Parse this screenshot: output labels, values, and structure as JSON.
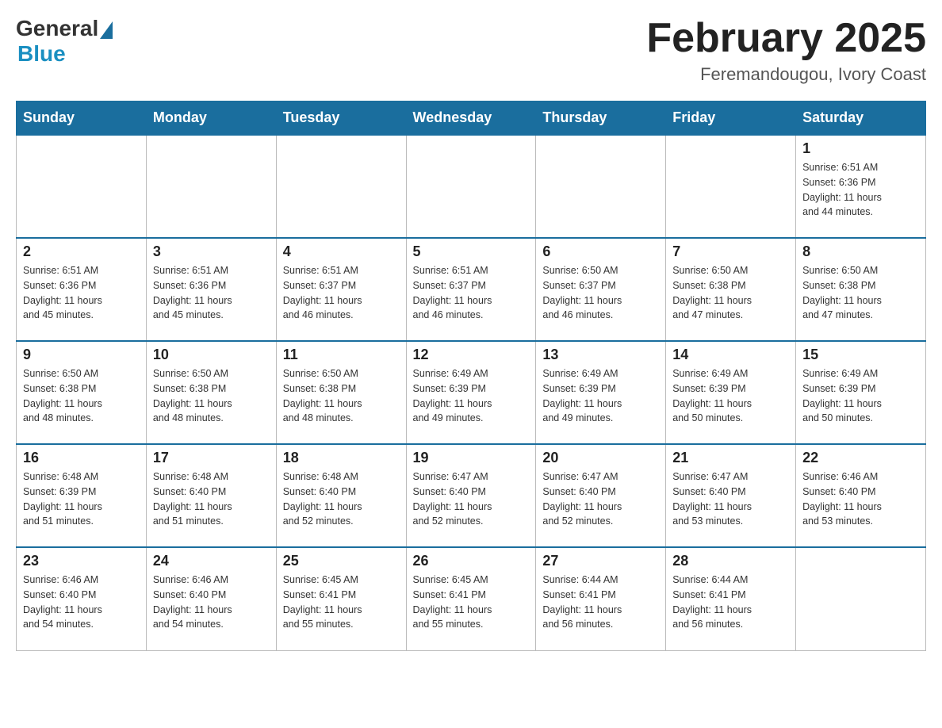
{
  "logo": {
    "general": "General",
    "blue": "Blue"
  },
  "title": "February 2025",
  "location": "Feremandougou, Ivory Coast",
  "days_of_week": [
    "Sunday",
    "Monday",
    "Tuesday",
    "Wednesday",
    "Thursday",
    "Friday",
    "Saturday"
  ],
  "weeks": [
    [
      {
        "day": "",
        "info": ""
      },
      {
        "day": "",
        "info": ""
      },
      {
        "day": "",
        "info": ""
      },
      {
        "day": "",
        "info": ""
      },
      {
        "day": "",
        "info": ""
      },
      {
        "day": "",
        "info": ""
      },
      {
        "day": "1",
        "info": "Sunrise: 6:51 AM\nSunset: 6:36 PM\nDaylight: 11 hours\nand 44 minutes."
      }
    ],
    [
      {
        "day": "2",
        "info": "Sunrise: 6:51 AM\nSunset: 6:36 PM\nDaylight: 11 hours\nand 45 minutes."
      },
      {
        "day": "3",
        "info": "Sunrise: 6:51 AM\nSunset: 6:36 PM\nDaylight: 11 hours\nand 45 minutes."
      },
      {
        "day": "4",
        "info": "Sunrise: 6:51 AM\nSunset: 6:37 PM\nDaylight: 11 hours\nand 46 minutes."
      },
      {
        "day": "5",
        "info": "Sunrise: 6:51 AM\nSunset: 6:37 PM\nDaylight: 11 hours\nand 46 minutes."
      },
      {
        "day": "6",
        "info": "Sunrise: 6:50 AM\nSunset: 6:37 PM\nDaylight: 11 hours\nand 46 minutes."
      },
      {
        "day": "7",
        "info": "Sunrise: 6:50 AM\nSunset: 6:38 PM\nDaylight: 11 hours\nand 47 minutes."
      },
      {
        "day": "8",
        "info": "Sunrise: 6:50 AM\nSunset: 6:38 PM\nDaylight: 11 hours\nand 47 minutes."
      }
    ],
    [
      {
        "day": "9",
        "info": "Sunrise: 6:50 AM\nSunset: 6:38 PM\nDaylight: 11 hours\nand 48 minutes."
      },
      {
        "day": "10",
        "info": "Sunrise: 6:50 AM\nSunset: 6:38 PM\nDaylight: 11 hours\nand 48 minutes."
      },
      {
        "day": "11",
        "info": "Sunrise: 6:50 AM\nSunset: 6:38 PM\nDaylight: 11 hours\nand 48 minutes."
      },
      {
        "day": "12",
        "info": "Sunrise: 6:49 AM\nSunset: 6:39 PM\nDaylight: 11 hours\nand 49 minutes."
      },
      {
        "day": "13",
        "info": "Sunrise: 6:49 AM\nSunset: 6:39 PM\nDaylight: 11 hours\nand 49 minutes."
      },
      {
        "day": "14",
        "info": "Sunrise: 6:49 AM\nSunset: 6:39 PM\nDaylight: 11 hours\nand 50 minutes."
      },
      {
        "day": "15",
        "info": "Sunrise: 6:49 AM\nSunset: 6:39 PM\nDaylight: 11 hours\nand 50 minutes."
      }
    ],
    [
      {
        "day": "16",
        "info": "Sunrise: 6:48 AM\nSunset: 6:39 PM\nDaylight: 11 hours\nand 51 minutes."
      },
      {
        "day": "17",
        "info": "Sunrise: 6:48 AM\nSunset: 6:40 PM\nDaylight: 11 hours\nand 51 minutes."
      },
      {
        "day": "18",
        "info": "Sunrise: 6:48 AM\nSunset: 6:40 PM\nDaylight: 11 hours\nand 52 minutes."
      },
      {
        "day": "19",
        "info": "Sunrise: 6:47 AM\nSunset: 6:40 PM\nDaylight: 11 hours\nand 52 minutes."
      },
      {
        "day": "20",
        "info": "Sunrise: 6:47 AM\nSunset: 6:40 PM\nDaylight: 11 hours\nand 52 minutes."
      },
      {
        "day": "21",
        "info": "Sunrise: 6:47 AM\nSunset: 6:40 PM\nDaylight: 11 hours\nand 53 minutes."
      },
      {
        "day": "22",
        "info": "Sunrise: 6:46 AM\nSunset: 6:40 PM\nDaylight: 11 hours\nand 53 minutes."
      }
    ],
    [
      {
        "day": "23",
        "info": "Sunrise: 6:46 AM\nSunset: 6:40 PM\nDaylight: 11 hours\nand 54 minutes."
      },
      {
        "day": "24",
        "info": "Sunrise: 6:46 AM\nSunset: 6:40 PM\nDaylight: 11 hours\nand 54 minutes."
      },
      {
        "day": "25",
        "info": "Sunrise: 6:45 AM\nSunset: 6:41 PM\nDaylight: 11 hours\nand 55 minutes."
      },
      {
        "day": "26",
        "info": "Sunrise: 6:45 AM\nSunset: 6:41 PM\nDaylight: 11 hours\nand 55 minutes."
      },
      {
        "day": "27",
        "info": "Sunrise: 6:44 AM\nSunset: 6:41 PM\nDaylight: 11 hours\nand 56 minutes."
      },
      {
        "day": "28",
        "info": "Sunrise: 6:44 AM\nSunset: 6:41 PM\nDaylight: 11 hours\nand 56 minutes."
      },
      {
        "day": "",
        "info": ""
      }
    ]
  ]
}
